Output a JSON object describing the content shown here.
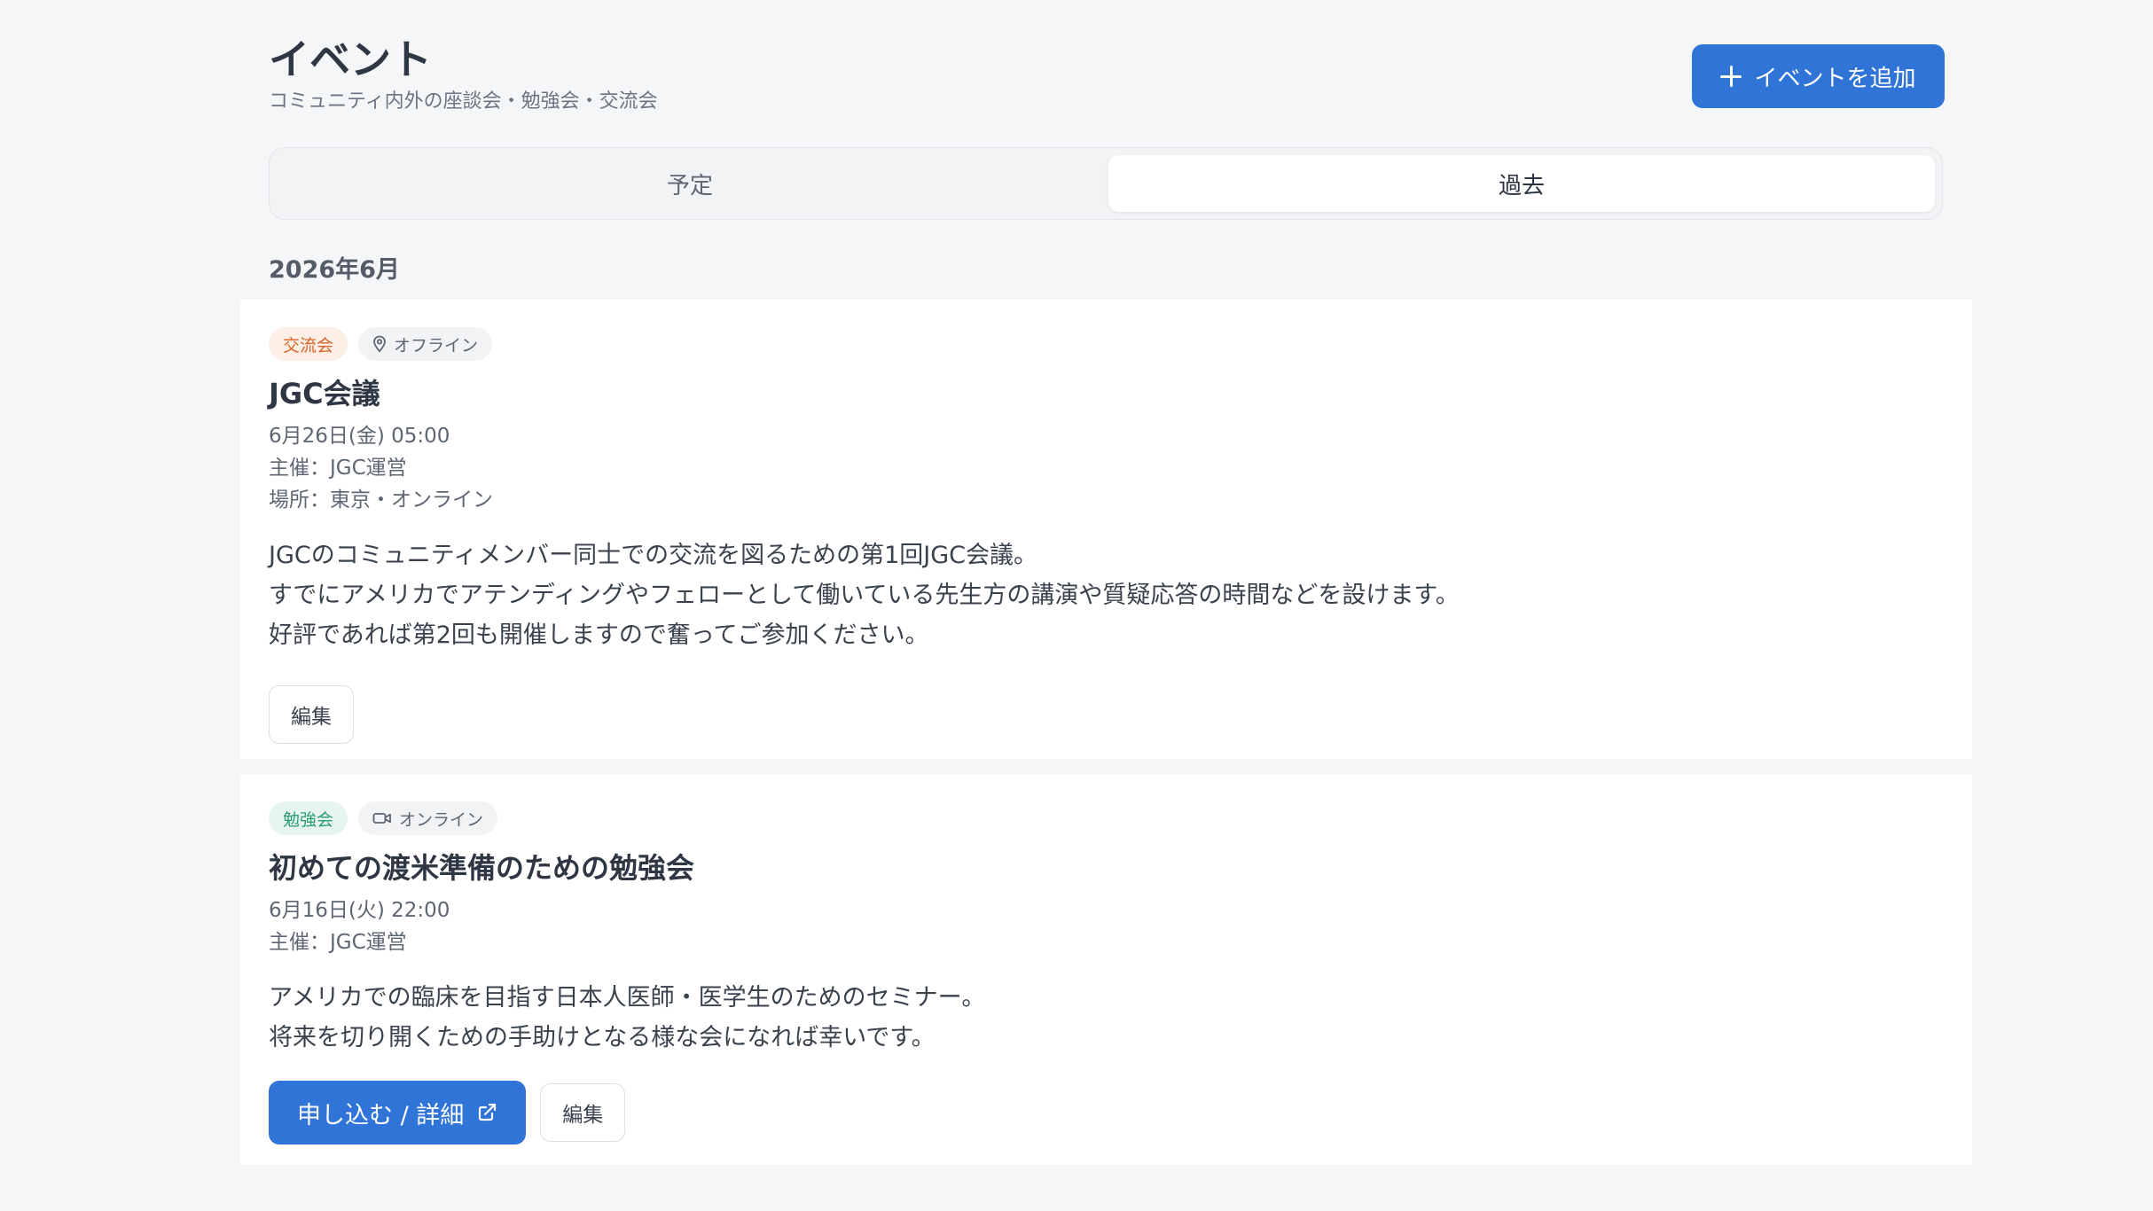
{
  "header": {
    "title": "イベント",
    "subtitle": "コミュニティ内外の座談会・勉強会・交流会",
    "add_button_label": "イベントを追加",
    "add_button_icon": "plus-icon"
  },
  "tabs": [
    {
      "label": "予定",
      "active": false
    },
    {
      "label": "過去",
      "active": true
    }
  ],
  "month_heading": "2026年6月",
  "colors": {
    "accent": "#2f74d6",
    "social_badge_text": "#d9652c",
    "study_badge_text": "#2e9c72"
  },
  "events": [
    {
      "category": "交流会",
      "format": "オフライン",
      "format_icon": "map-pin-icon",
      "title": "JGC会議",
      "datetime": "6月26日(金) 05:00",
      "organizer": "主催：JGC運営",
      "location": "場所：東京・オンライン",
      "description": [
        "JGCのコミュニティメンバー同士での交流を図るための第1回JGC会議。",
        "すでにアメリカでアテンディングやフェローとして働いている先生方の講演や質疑応答の時間などを設けます。",
        "好評であれば第2回も開催しますので奮ってご参加ください。"
      ],
      "edit_label": "編集"
    },
    {
      "category": "勉強会",
      "format": "オンライン",
      "format_icon": "video-icon",
      "title": "初めての渡米準備のための勉強会",
      "datetime": "6月16日(火) 22:00",
      "organizer": "主催：JGC運営",
      "description": [
        "アメリカでの臨床を目指す日本人医師・医学生のためのセミナー。",
        "将来を切り開くための手助けとなる様な会になれば幸いです。"
      ],
      "apply_label": "申し込む / 詳細",
      "apply_icon": "external-link-icon",
      "edit_label": "編集"
    }
  ]
}
